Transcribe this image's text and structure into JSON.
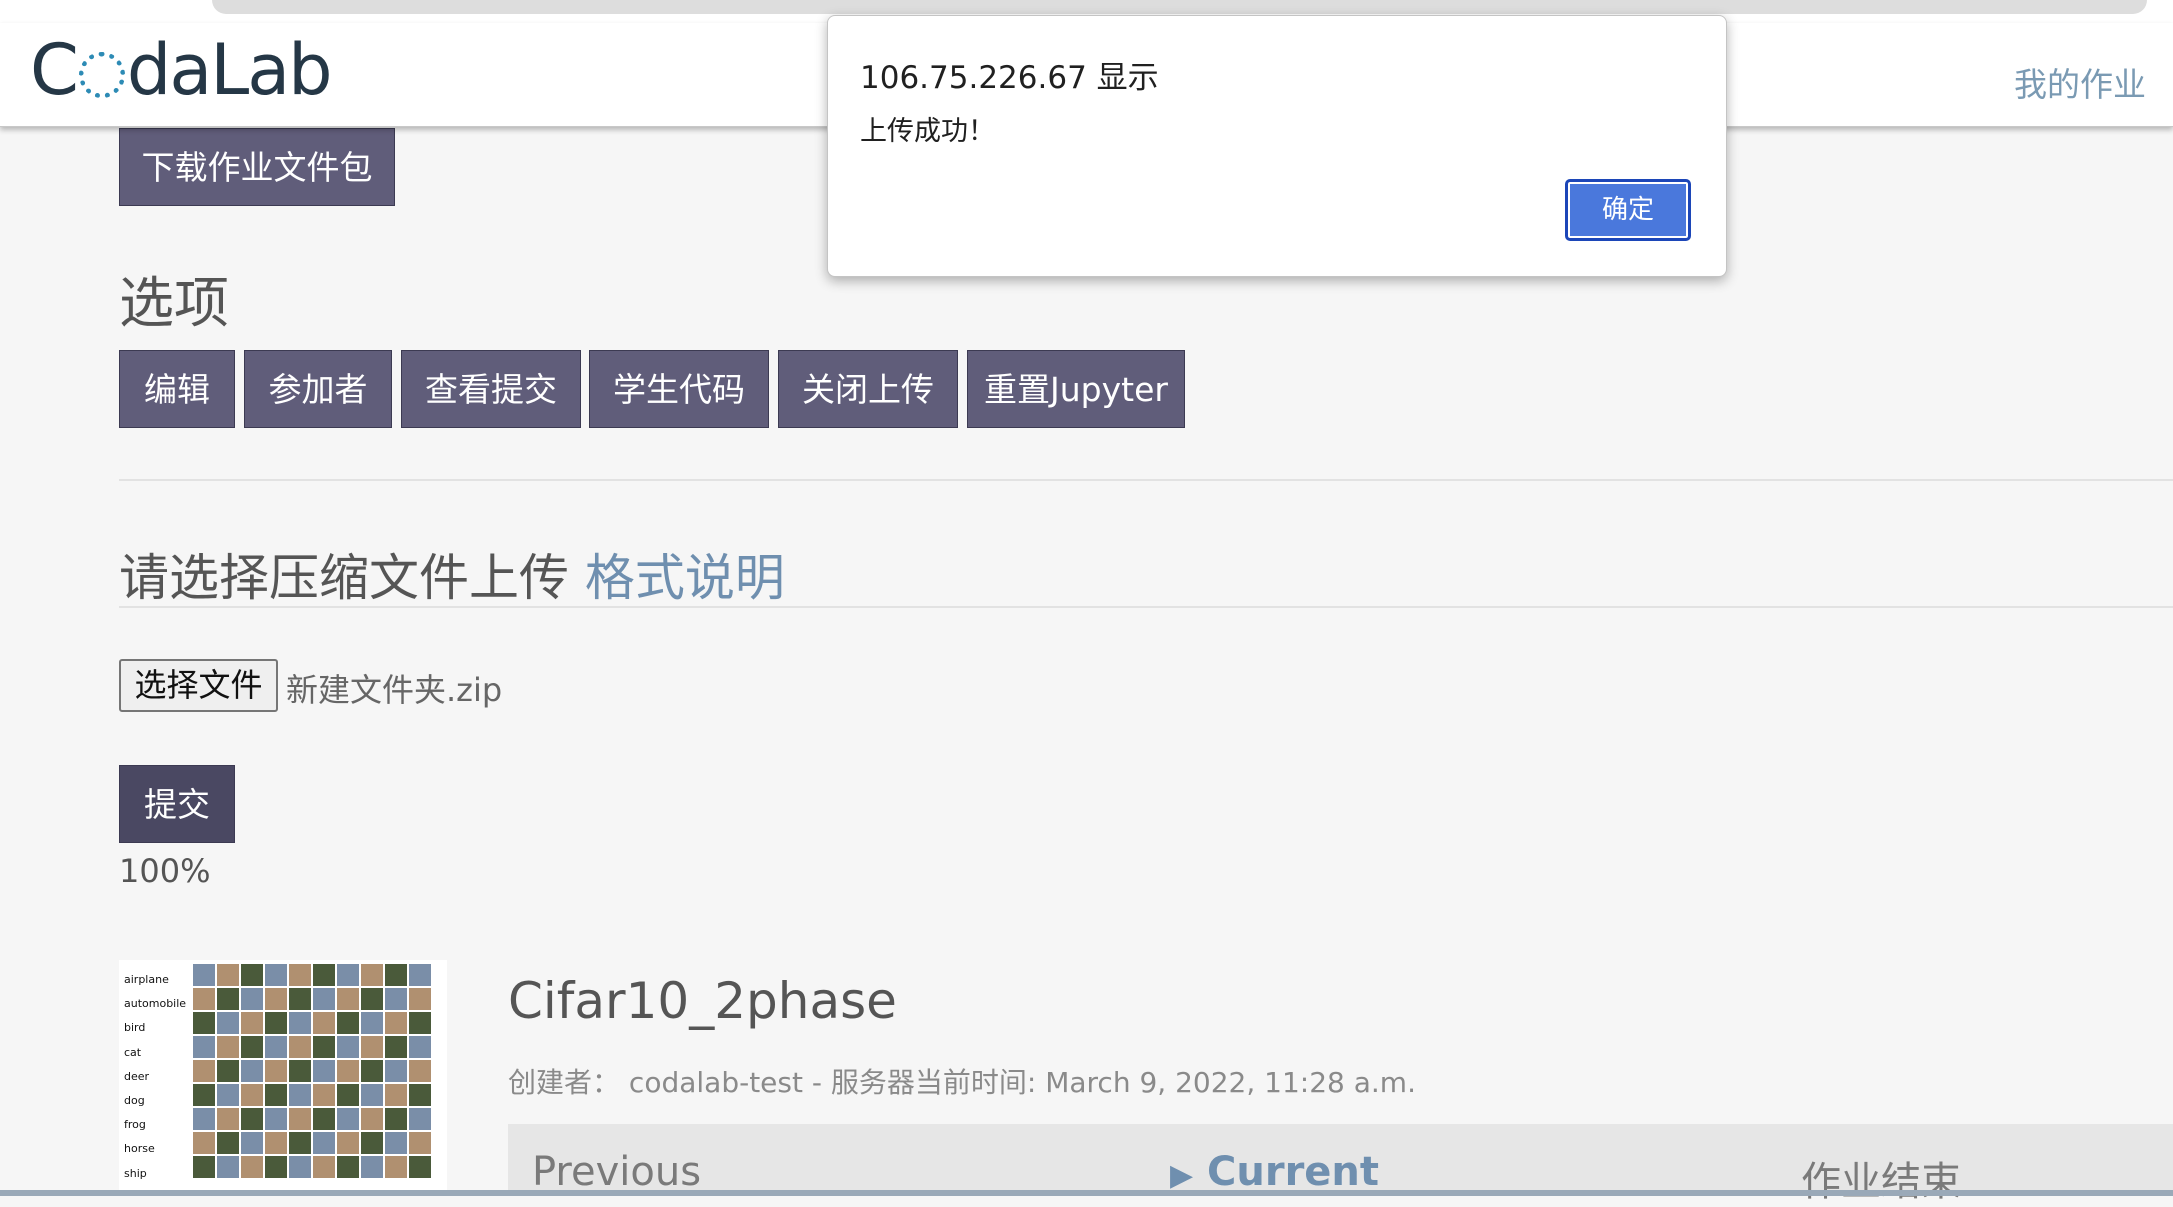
{
  "header": {
    "logo_text": "CodaLab",
    "nav_my_assignments": "我的作业"
  },
  "toolbar": {
    "download_label": "下载作业文件包"
  },
  "options": {
    "title": "选项",
    "buttons": [
      {
        "label": "编辑"
      },
      {
        "label": "参加者"
      },
      {
        "label": "查看提交"
      },
      {
        "label": "学生代码"
      },
      {
        "label": "关闭上传"
      },
      {
        "label": "重置Jupyter"
      }
    ]
  },
  "upload": {
    "title": "请选择压缩文件上传",
    "format_link": "格式说明",
    "choose_file_label": "选择文件",
    "file_name": "新建文件夹.zip",
    "submit_label": "提交",
    "progress_text": "100%",
    "progress_value": 1.0
  },
  "competition": {
    "thumbnail_labels": [
      "airplane",
      "automobile",
      "bird",
      "cat",
      "deer",
      "dog",
      "frog",
      "horse",
      "ship"
    ],
    "title": "Cifar10_2phase",
    "creator_label": "创建者：",
    "creator": "codalab-test",
    "server_time": "- 服务器当前时间: March 9, 2022, 11:28 a.m.",
    "phases": {
      "previous": "Previous",
      "current": "Current",
      "end": "作业结束"
    }
  },
  "dialog": {
    "host_line": "106.75.226.67 显示",
    "message": "上传成功！",
    "ok_label": "确定"
  },
  "colors": {
    "button_bg": "#605d7a",
    "link": "#6f8faf",
    "dialog_ok": "#4a78dc"
  }
}
